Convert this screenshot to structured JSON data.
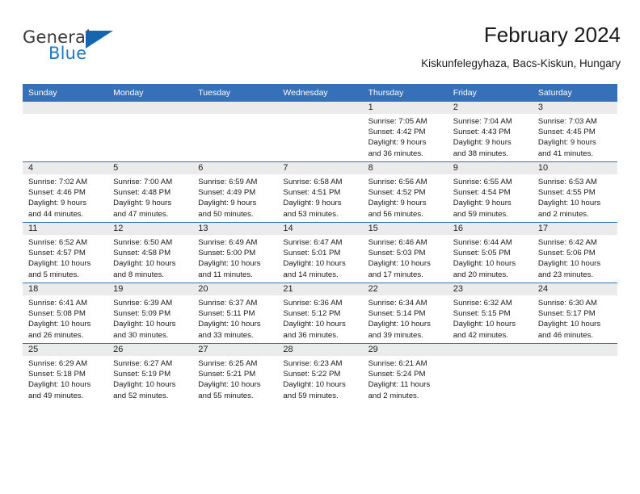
{
  "brand": {
    "name_part1": "General",
    "name_part2": "Blue",
    "triangle_color": "#1565b0",
    "blue_text_color": "#1f7ac2"
  },
  "header": {
    "title": "February 2024",
    "location": "Kiskunfelegyhaza, Bacs-Kiskun, Hungary"
  },
  "colors": {
    "header_row_bg": "#3570b8",
    "daynum_band_bg": "#ebebeb",
    "row_divider": "#3570b8",
    "text": "#1a1a1a"
  },
  "weekday_headers": [
    "Sunday",
    "Monday",
    "Tuesday",
    "Wednesday",
    "Thursday",
    "Friday",
    "Saturday"
  ],
  "weeks": [
    [
      {
        "day": "",
        "lines": [
          "",
          "",
          "",
          ""
        ]
      },
      {
        "day": "",
        "lines": [
          "",
          "",
          "",
          ""
        ]
      },
      {
        "day": "",
        "lines": [
          "",
          "",
          "",
          ""
        ]
      },
      {
        "day": "",
        "lines": [
          "",
          "",
          "",
          ""
        ]
      },
      {
        "day": "1",
        "lines": [
          "Sunrise: 7:05 AM",
          "Sunset: 4:42 PM",
          "Daylight: 9 hours",
          "and 36 minutes."
        ]
      },
      {
        "day": "2",
        "lines": [
          "Sunrise: 7:04 AM",
          "Sunset: 4:43 PM",
          "Daylight: 9 hours",
          "and 38 minutes."
        ]
      },
      {
        "day": "3",
        "lines": [
          "Sunrise: 7:03 AM",
          "Sunset: 4:45 PM",
          "Daylight: 9 hours",
          "and 41 minutes."
        ]
      }
    ],
    [
      {
        "day": "4",
        "lines": [
          "Sunrise: 7:02 AM",
          "Sunset: 4:46 PM",
          "Daylight: 9 hours",
          "and 44 minutes."
        ]
      },
      {
        "day": "5",
        "lines": [
          "Sunrise: 7:00 AM",
          "Sunset: 4:48 PM",
          "Daylight: 9 hours",
          "and 47 minutes."
        ]
      },
      {
        "day": "6",
        "lines": [
          "Sunrise: 6:59 AM",
          "Sunset: 4:49 PM",
          "Daylight: 9 hours",
          "and 50 minutes."
        ]
      },
      {
        "day": "7",
        "lines": [
          "Sunrise: 6:58 AM",
          "Sunset: 4:51 PM",
          "Daylight: 9 hours",
          "and 53 minutes."
        ]
      },
      {
        "day": "8",
        "lines": [
          "Sunrise: 6:56 AM",
          "Sunset: 4:52 PM",
          "Daylight: 9 hours",
          "and 56 minutes."
        ]
      },
      {
        "day": "9",
        "lines": [
          "Sunrise: 6:55 AM",
          "Sunset: 4:54 PM",
          "Daylight: 9 hours",
          "and 59 minutes."
        ]
      },
      {
        "day": "10",
        "lines": [
          "Sunrise: 6:53 AM",
          "Sunset: 4:55 PM",
          "Daylight: 10 hours",
          "and 2 minutes."
        ]
      }
    ],
    [
      {
        "day": "11",
        "lines": [
          "Sunrise: 6:52 AM",
          "Sunset: 4:57 PM",
          "Daylight: 10 hours",
          "and 5 minutes."
        ]
      },
      {
        "day": "12",
        "lines": [
          "Sunrise: 6:50 AM",
          "Sunset: 4:58 PM",
          "Daylight: 10 hours",
          "and 8 minutes."
        ]
      },
      {
        "day": "13",
        "lines": [
          "Sunrise: 6:49 AM",
          "Sunset: 5:00 PM",
          "Daylight: 10 hours",
          "and 11 minutes."
        ]
      },
      {
        "day": "14",
        "lines": [
          "Sunrise: 6:47 AM",
          "Sunset: 5:01 PM",
          "Daylight: 10 hours",
          "and 14 minutes."
        ]
      },
      {
        "day": "15",
        "lines": [
          "Sunrise: 6:46 AM",
          "Sunset: 5:03 PM",
          "Daylight: 10 hours",
          "and 17 minutes."
        ]
      },
      {
        "day": "16",
        "lines": [
          "Sunrise: 6:44 AM",
          "Sunset: 5:05 PM",
          "Daylight: 10 hours",
          "and 20 minutes."
        ]
      },
      {
        "day": "17",
        "lines": [
          "Sunrise: 6:42 AM",
          "Sunset: 5:06 PM",
          "Daylight: 10 hours",
          "and 23 minutes."
        ]
      }
    ],
    [
      {
        "day": "18",
        "lines": [
          "Sunrise: 6:41 AM",
          "Sunset: 5:08 PM",
          "Daylight: 10 hours",
          "and 26 minutes."
        ]
      },
      {
        "day": "19",
        "lines": [
          "Sunrise: 6:39 AM",
          "Sunset: 5:09 PM",
          "Daylight: 10 hours",
          "and 30 minutes."
        ]
      },
      {
        "day": "20",
        "lines": [
          "Sunrise: 6:37 AM",
          "Sunset: 5:11 PM",
          "Daylight: 10 hours",
          "and 33 minutes."
        ]
      },
      {
        "day": "21",
        "lines": [
          "Sunrise: 6:36 AM",
          "Sunset: 5:12 PM",
          "Daylight: 10 hours",
          "and 36 minutes."
        ]
      },
      {
        "day": "22",
        "lines": [
          "Sunrise: 6:34 AM",
          "Sunset: 5:14 PM",
          "Daylight: 10 hours",
          "and 39 minutes."
        ]
      },
      {
        "day": "23",
        "lines": [
          "Sunrise: 6:32 AM",
          "Sunset: 5:15 PM",
          "Daylight: 10 hours",
          "and 42 minutes."
        ]
      },
      {
        "day": "24",
        "lines": [
          "Sunrise: 6:30 AM",
          "Sunset: 5:17 PM",
          "Daylight: 10 hours",
          "and 46 minutes."
        ]
      }
    ],
    [
      {
        "day": "25",
        "lines": [
          "Sunrise: 6:29 AM",
          "Sunset: 5:18 PM",
          "Daylight: 10 hours",
          "and 49 minutes."
        ]
      },
      {
        "day": "26",
        "lines": [
          "Sunrise: 6:27 AM",
          "Sunset: 5:19 PM",
          "Daylight: 10 hours",
          "and 52 minutes."
        ]
      },
      {
        "day": "27",
        "lines": [
          "Sunrise: 6:25 AM",
          "Sunset: 5:21 PM",
          "Daylight: 10 hours",
          "and 55 minutes."
        ]
      },
      {
        "day": "28",
        "lines": [
          "Sunrise: 6:23 AM",
          "Sunset: 5:22 PM",
          "Daylight: 10 hours",
          "and 59 minutes."
        ]
      },
      {
        "day": "29",
        "lines": [
          "Sunrise: 6:21 AM",
          "Sunset: 5:24 PM",
          "Daylight: 11 hours",
          "and 2 minutes."
        ]
      },
      {
        "day": "",
        "lines": [
          "",
          "",
          "",
          ""
        ]
      },
      {
        "day": "",
        "lines": [
          "",
          "",
          "",
          ""
        ]
      }
    ]
  ]
}
